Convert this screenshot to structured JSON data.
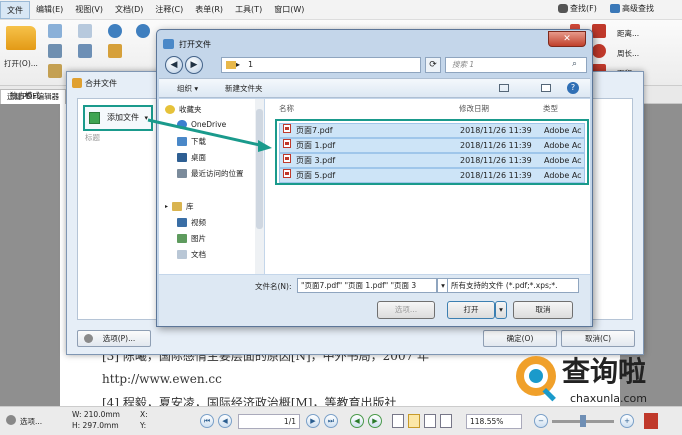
{
  "menubar": {
    "items": [
      "文件",
      "编辑(E)",
      "视图(V)",
      "文档(D)",
      "注释(C)",
      "表单(R)",
      "工具(T)",
      "窗口(W)"
    ],
    "find": "查找(F)",
    "advanced_find": "高级查找"
  },
  "ribbon": {
    "open": "打开(O)...",
    "zoom_value": "118.55%",
    "distance": "距离...",
    "perimeter": "周长...",
    "area": "面积..."
  },
  "tabs": {
    "exclusive_mode": "独占模式",
    "doc_tab": "迅捷PDF编辑器"
  },
  "document": {
    "line1": "[3] 陈曦，国际感情主要层面的原因[N]，中外书局，2007 年",
    "line2": "http://www.ewen.cc",
    "line3": "[4] 程毅，夏安凌，国际经济政治概[M]，等教育出版社"
  },
  "merge_dialog": {
    "title": "合并文件",
    "add_file_button": "添加文件",
    "column_header": "标题",
    "options_button": "选项(P)...",
    "merge_button": "确定(O)",
    "cancel_button": "取消(C)"
  },
  "open_dialog": {
    "title": "打开文件",
    "address_folder": "1",
    "search_placeholder": "搜索 1",
    "organize": "组织",
    "new_folder": "新建文件夹",
    "nav_items": [
      "收藏夹",
      "OneDrive",
      "下载",
      "桌面",
      "最近访问的位置",
      "库",
      "视频",
      "图片",
      "文档"
    ],
    "columns": {
      "name": "名称",
      "date": "修改日期",
      "type": "类型"
    },
    "files": [
      {
        "name": "页面7.pdf",
        "date": "2018/11/26 11:39",
        "type": "Adobe Ac"
      },
      {
        "name": "页面 1.pdf",
        "date": "2018/11/26 11:39",
        "type": "Adobe Ac"
      },
      {
        "name": "页面 3.pdf",
        "date": "2018/11/26 11:39",
        "type": "Adobe Ac"
      },
      {
        "name": "页面 5.pdf",
        "date": "2018/11/26 11:39",
        "type": "Adobe Ac"
      }
    ],
    "filename_label": "文件名(N):",
    "filename_value": "\"页面7.pdf\" \"页面 1.pdf\" \"页面 3",
    "filetype_value": "所有支持的文件 (*.pdf;*.xps;*.",
    "options_button": "选项...",
    "open_button": "打开",
    "cancel_button": "取消"
  },
  "statusbar": {
    "options": "选项...",
    "width": "W: 210.0mm",
    "height": "H: 297.0mm",
    "x": "X:",
    "y": "Y:",
    "page": "1/1",
    "zoom": "118.55%"
  },
  "watermark": {
    "brand": "查询啦",
    "domain": "chaxunla.com"
  },
  "colors": {
    "highlight": "#1a9a8c",
    "selection": "#cde4f7",
    "dialog_frame": "#c4d6ea"
  }
}
